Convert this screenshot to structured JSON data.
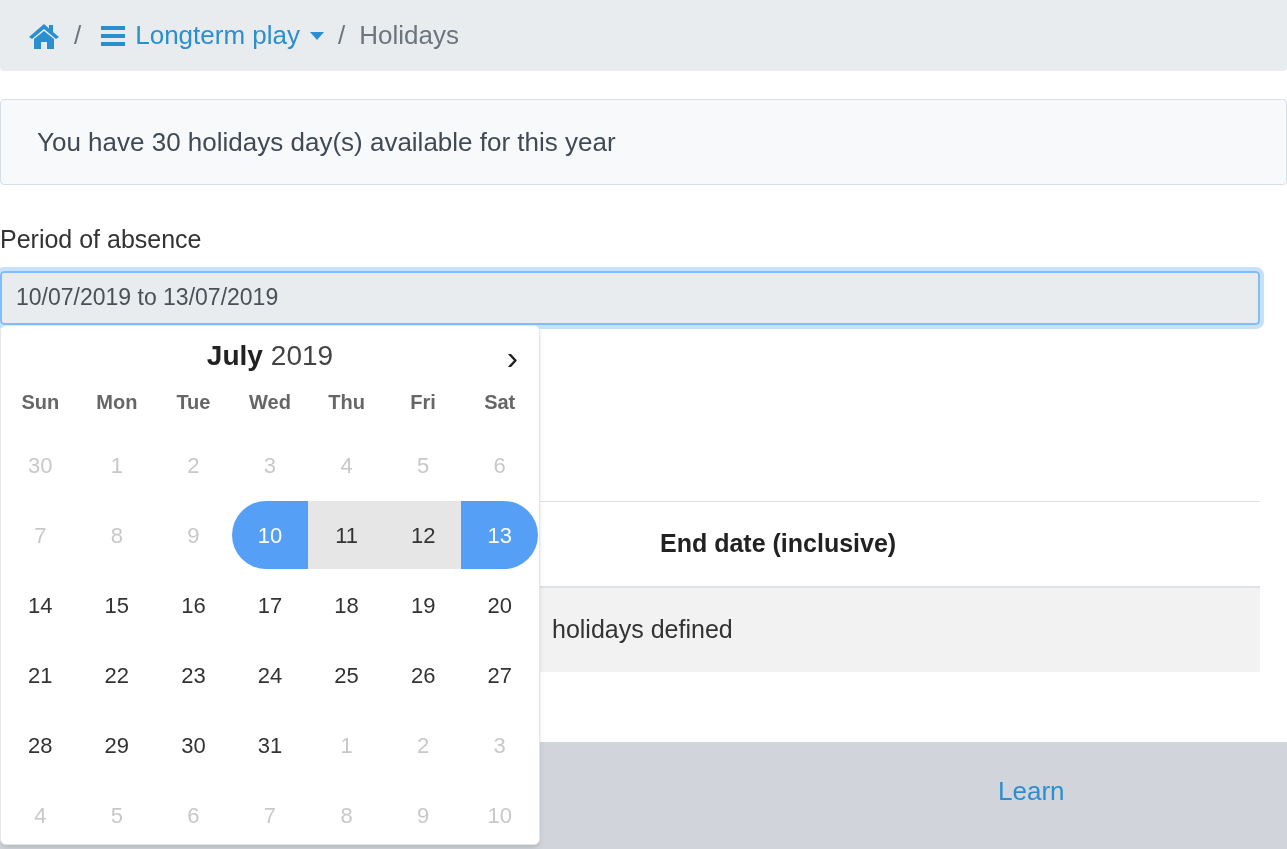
{
  "breadcrumb": {
    "separators": [
      "/",
      "/"
    ],
    "section": "Longterm play",
    "current": "Holidays"
  },
  "alert": "You have 30 holidays day(s) available for this year",
  "period": {
    "label": "Period of absence",
    "value": "10/07/2019 to 13/07/2019"
  },
  "table": {
    "columns": [
      "End date (inclusive)"
    ],
    "empty_text": "holidays defined"
  },
  "footer": {
    "heading": "Learn"
  },
  "calendar": {
    "month": "July",
    "year": "2019",
    "next": "›",
    "weekdays": [
      "Sun",
      "Mon",
      "Tue",
      "Wed",
      "Thu",
      "Fri",
      "Sat"
    ],
    "weeks": [
      [
        {
          "label": "30",
          "kind": "outside"
        },
        {
          "label": "1",
          "kind": "outside"
        },
        {
          "label": "2",
          "kind": "outside"
        },
        {
          "label": "3",
          "kind": "outside"
        },
        {
          "label": "4",
          "kind": "outside"
        },
        {
          "label": "5",
          "kind": "outside"
        },
        {
          "label": "6",
          "kind": "outside"
        }
      ],
      [
        {
          "label": "7",
          "kind": "outside"
        },
        {
          "label": "8",
          "kind": "outside"
        },
        {
          "label": "9",
          "kind": "outside"
        },
        {
          "label": "10",
          "kind": "start"
        },
        {
          "label": "11",
          "kind": "in-range"
        },
        {
          "label": "12",
          "kind": "in-range"
        },
        {
          "label": "13",
          "kind": "end"
        }
      ],
      [
        {
          "label": "14",
          "kind": "normal"
        },
        {
          "label": "15",
          "kind": "normal"
        },
        {
          "label": "16",
          "kind": "normal"
        },
        {
          "label": "17",
          "kind": "normal"
        },
        {
          "label": "18",
          "kind": "normal"
        },
        {
          "label": "19",
          "kind": "normal"
        },
        {
          "label": "20",
          "kind": "normal"
        }
      ],
      [
        {
          "label": "21",
          "kind": "normal"
        },
        {
          "label": "22",
          "kind": "normal"
        },
        {
          "label": "23",
          "kind": "normal"
        },
        {
          "label": "24",
          "kind": "normal"
        },
        {
          "label": "25",
          "kind": "normal"
        },
        {
          "label": "26",
          "kind": "normal"
        },
        {
          "label": "27",
          "kind": "normal"
        }
      ],
      [
        {
          "label": "28",
          "kind": "normal"
        },
        {
          "label": "29",
          "kind": "normal"
        },
        {
          "label": "30",
          "kind": "normal"
        },
        {
          "label": "31",
          "kind": "normal"
        },
        {
          "label": "1",
          "kind": "outside"
        },
        {
          "label": "2",
          "kind": "outside"
        },
        {
          "label": "3",
          "kind": "outside"
        }
      ],
      [
        {
          "label": "4",
          "kind": "outside"
        },
        {
          "label": "5",
          "kind": "outside"
        },
        {
          "label": "6",
          "kind": "outside"
        },
        {
          "label": "7",
          "kind": "outside"
        },
        {
          "label": "8",
          "kind": "outside"
        },
        {
          "label": "9",
          "kind": "outside"
        },
        {
          "label": "10",
          "kind": "outside"
        }
      ]
    ]
  }
}
